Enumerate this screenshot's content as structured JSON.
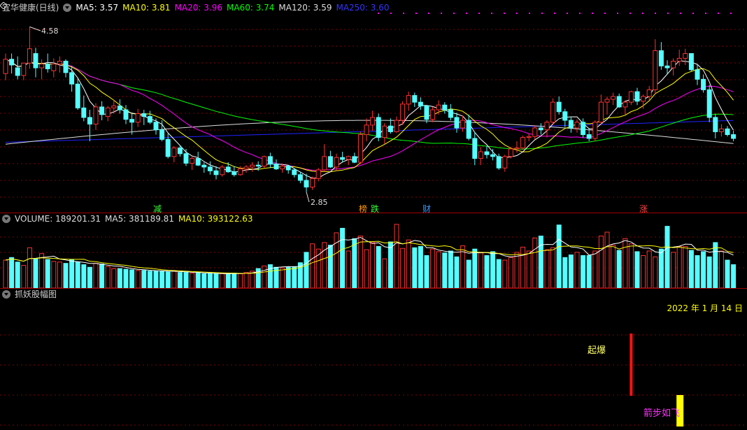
{
  "main": {
    "title": "宜华健康(日线)",
    "ma": [
      {
        "label": "MA5: 3.57",
        "color": "#ffffff"
      },
      {
        "label": "MA10: 3.81",
        "color": "#ffff00"
      },
      {
        "label": "MA20: 3.96",
        "color": "#ff00ff"
      },
      {
        "label": "MA60: 3.74",
        "color": "#00ff00"
      },
      {
        "label": "MA120: 3.59",
        "color": "#e0e0e0"
      },
      {
        "label": "MA250: 3.60",
        "color": "#0000ff"
      }
    ],
    "high_label": "4.58",
    "low_label": "2.85",
    "markers": [
      {
        "text": "减",
        "color": "#33ff33"
      },
      {
        "text": "榜",
        "color": "#ff9900"
      },
      {
        "text": "跌",
        "color": "#33ff33"
      },
      {
        "text": "财",
        "color": "#3399ff"
      },
      {
        "text": "涨",
        "color": "#ff4444"
      }
    ]
  },
  "volume": {
    "label": "VOLUME: 189201.31",
    "ma5": "MA5: 381189.81",
    "ma10": "MA10: 393122.63"
  },
  "indicator": {
    "title": "抓妖股幅图",
    "date": "2022 年 1 月 14 日",
    "signal1": "起爆",
    "signal2": "箭步如飞"
  },
  "colors": {
    "up": "#ff3232",
    "down": "#54ffff",
    "grid": "#800000",
    "sep": "#a00000"
  },
  "chart_data": {
    "type": "candlestick",
    "price_range": [
      2.85,
      4.58
    ],
    "candles": [
      [
        4.09,
        4.3,
        4.02,
        4.24
      ],
      [
        4.24,
        4.3,
        4.09,
        4.18
      ],
      [
        4.15,
        4.27,
        4.03,
        4.07
      ],
      [
        4.07,
        4.2,
        4.02,
        4.2
      ],
      [
        4.2,
        4.58,
        4.14,
        4.35
      ],
      [
        4.3,
        4.36,
        4.05,
        4.15
      ],
      [
        4.15,
        4.24,
        4.03,
        4.19
      ],
      [
        4.19,
        4.3,
        4.1,
        4.14
      ],
      [
        4.12,
        4.25,
        4.05,
        4.19
      ],
      [
        4.19,
        4.27,
        4.1,
        4.22
      ],
      [
        4.22,
        4.24,
        4.05,
        4.1
      ],
      [
        4.1,
        4.17,
        3.9,
        3.98
      ],
      [
        3.98,
        4.05,
        3.71,
        3.73
      ],
      [
        3.73,
        3.86,
        3.59,
        3.63
      ],
      [
        3.63,
        3.71,
        3.38,
        3.56
      ],
      [
        3.56,
        3.78,
        3.5,
        3.74
      ],
      [
        3.74,
        3.8,
        3.6,
        3.66
      ],
      [
        3.64,
        3.75,
        3.59,
        3.73
      ],
      [
        3.73,
        3.81,
        3.67,
        3.75
      ],
      [
        3.75,
        3.82,
        3.67,
        3.71
      ],
      [
        3.71,
        3.76,
        3.56,
        3.61
      ],
      [
        3.61,
        3.68,
        3.45,
        3.58
      ],
      [
        3.58,
        3.72,
        3.53,
        3.67
      ],
      [
        3.67,
        3.71,
        3.55,
        3.64
      ],
      [
        3.64,
        3.7,
        3.56,
        3.58
      ],
      [
        3.58,
        3.62,
        3.45,
        3.5
      ],
      [
        3.5,
        3.6,
        3.38,
        3.4
      ],
      [
        3.4,
        3.46,
        3.2,
        3.22
      ],
      [
        3.22,
        3.33,
        3.16,
        3.31
      ],
      [
        3.31,
        3.34,
        3.22,
        3.25
      ],
      [
        3.25,
        3.3,
        3.12,
        3.15
      ],
      [
        3.15,
        3.22,
        3.08,
        3.2
      ],
      [
        3.2,
        3.27,
        3.12,
        3.13
      ],
      [
        3.13,
        3.16,
        3.05,
        3.11
      ],
      [
        3.11,
        3.17,
        3.03,
        3.07
      ],
      [
        3.07,
        3.12,
        2.98,
        3.03
      ],
      [
        3.03,
        3.13,
        3.01,
        3.11
      ],
      [
        3.11,
        3.16,
        3.05,
        3.06
      ],
      [
        3.06,
        3.12,
        3.01,
        3.03
      ],
      [
        3.03,
        3.12,
        3.02,
        3.09
      ],
      [
        3.09,
        3.13,
        3.05,
        3.11
      ],
      [
        3.11,
        3.16,
        3.06,
        3.13
      ],
      [
        3.13,
        3.17,
        3.07,
        3.12
      ],
      [
        3.12,
        3.23,
        3.1,
        3.22
      ],
      [
        3.22,
        3.26,
        3.1,
        3.14
      ],
      [
        3.14,
        3.19,
        3.08,
        3.09
      ],
      [
        3.09,
        3.14,
        3.05,
        3.12
      ],
      [
        3.12,
        3.13,
        3.04,
        3.08
      ],
      [
        3.08,
        3.1,
        3.0,
        3.03
      ],
      [
        3.03,
        3.06,
        2.94,
        2.97
      ],
      [
        2.97,
        3.04,
        2.85,
        2.9
      ],
      [
        2.9,
        3.01,
        2.87,
        2.99
      ],
      [
        2.99,
        3.1,
        2.96,
        3.08
      ],
      [
        3.08,
        3.35,
        3.06,
        3.22
      ],
      [
        3.22,
        3.28,
        3.1,
        3.11
      ],
      [
        3.11,
        3.25,
        3.07,
        3.21
      ],
      [
        3.21,
        3.27,
        3.16,
        3.19
      ],
      [
        3.19,
        3.23,
        3.13,
        3.22
      ],
      [
        3.22,
        3.26,
        3.15,
        3.16
      ],
      [
        3.16,
        3.48,
        3.14,
        3.45
      ],
      [
        3.45,
        3.62,
        3.38,
        3.55
      ],
      [
        3.55,
        3.7,
        3.49,
        3.63
      ],
      [
        3.63,
        3.67,
        3.38,
        3.42
      ],
      [
        3.42,
        3.57,
        3.35,
        3.54
      ],
      [
        3.54,
        3.62,
        3.46,
        3.48
      ],
      [
        3.48,
        3.64,
        3.47,
        3.6
      ],
      [
        3.6,
        3.8,
        3.55,
        3.77
      ],
      [
        3.77,
        3.9,
        3.7,
        3.86
      ],
      [
        3.86,
        3.89,
        3.74,
        3.79
      ],
      [
        3.79,
        3.84,
        3.71,
        3.75
      ],
      [
        3.75,
        3.76,
        3.57,
        3.61
      ],
      [
        3.61,
        3.74,
        3.58,
        3.71
      ],
      [
        3.71,
        3.81,
        3.66,
        3.76
      ],
      [
        3.76,
        3.79,
        3.67,
        3.71
      ],
      [
        3.71,
        3.77,
        3.6,
        3.63
      ],
      [
        3.63,
        3.68,
        3.47,
        3.52
      ],
      [
        3.52,
        3.65,
        3.48,
        3.6
      ],
      [
        3.6,
        3.66,
        3.39,
        3.41
      ],
      [
        3.41,
        3.48,
        3.13,
        3.2
      ],
      [
        3.2,
        3.32,
        3.13,
        3.27
      ],
      [
        3.27,
        3.33,
        3.2,
        3.24
      ],
      [
        3.24,
        3.3,
        3.18,
        3.22
      ],
      [
        3.22,
        3.25,
        3.08,
        3.1
      ],
      [
        3.1,
        3.24,
        3.06,
        3.22
      ],
      [
        3.22,
        3.32,
        3.2,
        3.3
      ],
      [
        3.3,
        3.38,
        3.26,
        3.31
      ],
      [
        3.31,
        3.44,
        3.29,
        3.42
      ],
      [
        3.42,
        3.46,
        3.38,
        3.43
      ],
      [
        3.43,
        3.55,
        3.4,
        3.52
      ],
      [
        3.52,
        3.57,
        3.45,
        3.5
      ],
      [
        3.5,
        3.6,
        3.42,
        3.58
      ],
      [
        3.58,
        3.83,
        3.55,
        3.79
      ],
      [
        3.79,
        3.85,
        3.66,
        3.69
      ],
      [
        3.69,
        3.72,
        3.53,
        3.6
      ],
      [
        3.6,
        3.64,
        3.47,
        3.52
      ],
      [
        3.52,
        3.61,
        3.47,
        3.58
      ],
      [
        3.58,
        3.62,
        3.42,
        3.45
      ],
      [
        3.45,
        3.52,
        3.38,
        3.41
      ],
      [
        3.41,
        3.6,
        3.38,
        3.58
      ],
      [
        3.58,
        3.87,
        3.55,
        3.79
      ],
      [
        3.79,
        3.85,
        3.66,
        3.82
      ],
      [
        3.82,
        3.89,
        3.76,
        3.85
      ],
      [
        3.85,
        3.88,
        3.73,
        3.74
      ],
      [
        3.74,
        3.81,
        3.66,
        3.79
      ],
      [
        3.79,
        3.91,
        3.76,
        3.9
      ],
      [
        3.9,
        3.94,
        3.76,
        3.8
      ],
      [
        3.8,
        3.87,
        3.72,
        3.85
      ],
      [
        3.85,
        3.96,
        3.81,
        3.92
      ],
      [
        3.92,
        4.45,
        3.87,
        4.33
      ],
      [
        4.33,
        4.42,
        4.13,
        4.17
      ],
      [
        4.17,
        4.23,
        4.08,
        4.15
      ],
      [
        4.15,
        4.25,
        4.07,
        4.22
      ],
      [
        4.22,
        4.34,
        4.17,
        4.25
      ],
      [
        4.25,
        4.35,
        4.18,
        4.3
      ],
      [
        4.3,
        4.29,
        4.11,
        4.13
      ],
      [
        4.13,
        4.19,
        3.97,
        4.03
      ],
      [
        4.03,
        4.08,
        3.89,
        3.92
      ],
      [
        3.92,
        3.97,
        3.58,
        3.63
      ],
      [
        3.63,
        3.67,
        3.41,
        3.48
      ],
      [
        3.48,
        3.56,
        3.43,
        3.51
      ],
      [
        3.51,
        3.54,
        3.43,
        3.45
      ],
      [
        3.45,
        3.49,
        3.38,
        3.41
      ]
    ],
    "volume": [
      43,
      47,
      40,
      35,
      62,
      45,
      53,
      44,
      41,
      40,
      38,
      44,
      40,
      36,
      32,
      38,
      37,
      33,
      30,
      30,
      29,
      28,
      27,
      27,
      26,
      26,
      26,
      25,
      26,
      24,
      24,
      23,
      24,
      22,
      22,
      22,
      22,
      22,
      23,
      22,
      24,
      26,
      30,
      34,
      36,
      32,
      31,
      32,
      33,
      39,
      55,
      68,
      60,
      70,
      66,
      85,
      92,
      57,
      76,
      80,
      59,
      70,
      64,
      45,
      71,
      98,
      61,
      74,
      62,
      64,
      50,
      60,
      56,
      54,
      57,
      48,
      65,
      43,
      60,
      55,
      50,
      56,
      44,
      43,
      47,
      55,
      63,
      57,
      77,
      80,
      59,
      62,
      97,
      47,
      51,
      55,
      50,
      50,
      57,
      80,
      86,
      66,
      58,
      76,
      68,
      56,
      50,
      57,
      48,
      60,
      95,
      55,
      64,
      64,
      58,
      50,
      56,
      48,
      70,
      57,
      43,
      36,
      30
    ],
    "signals": [
      {
        "index": 104,
        "name": "起爆",
        "value": 1.0
      },
      {
        "index": 112,
        "name": "箭步如飞",
        "value": 0.5
      }
    ]
  }
}
